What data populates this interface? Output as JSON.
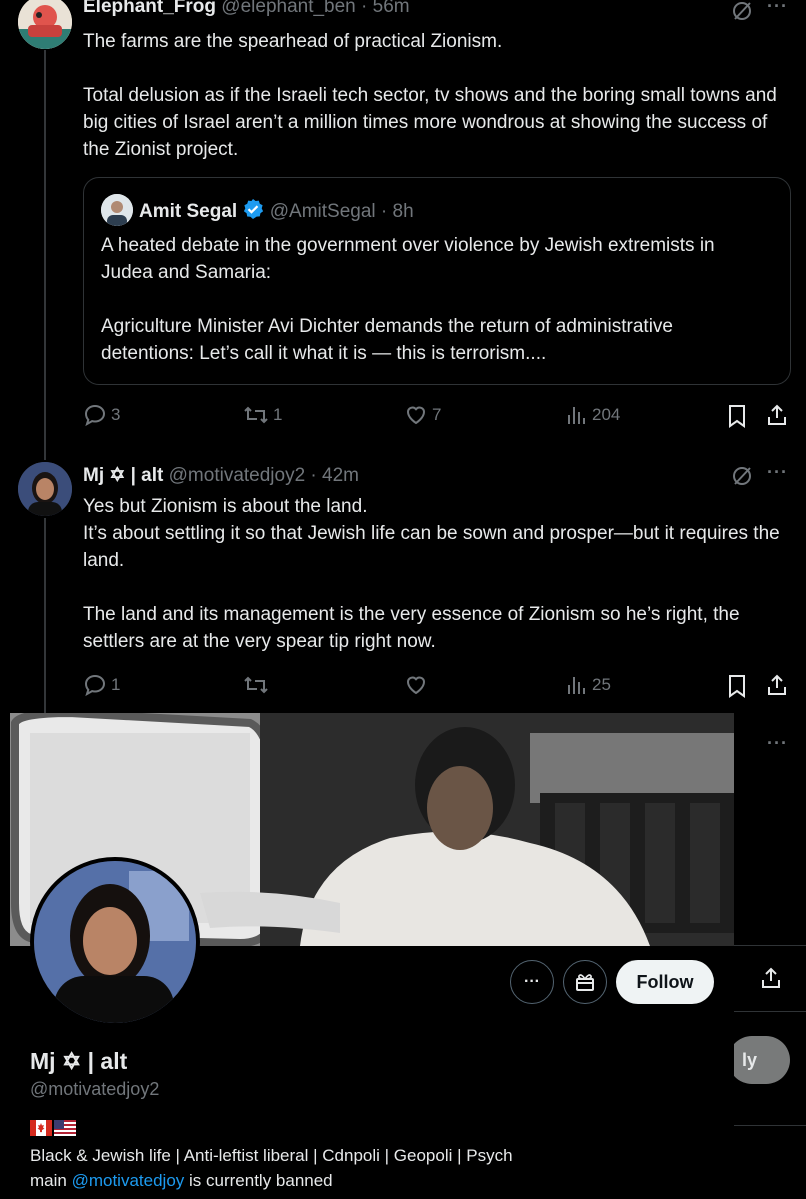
{
  "tweet1": {
    "display_name": "Elephant_Frog",
    "handle_time": "@elephant_ben · 56m",
    "paragraphs": [
      "The farms are the spearhead of practical Zionism.",
      "Total delusion as if the Israeli tech sector, tv shows and the boring small towns and big cities of Israel aren’t a million times more wondrous at showing the success of the Zionist project."
    ],
    "quote": {
      "display_name": "Amit Segal",
      "handle_time": "@AmitSegal · 8h",
      "paragraphs": [
        "A heated debate in the government over violence by Jewish extremists in Judea and Samaria:",
        "Agriculture Minister Avi Dichter demands the return of administrative detentions: Let’s call it what it is — this is terrorism...."
      ]
    },
    "actions": {
      "replies": "3",
      "reposts": "1",
      "likes": "7",
      "views": "204"
    }
  },
  "tweet2": {
    "display_name": "Mj ✡︎ | alt",
    "handle_time": "@motivatedjoy2 · 42m",
    "paragraphs": [
      "Yes but Zionism is about the land.",
      "It’s about settling it so that Jewish life can be sown and prosper—but it requires the land.",
      "The land and its management is the very essence of Zionism so he’s right, the settlers are at the very spear tip right now."
    ],
    "actions": {
      "replies": "1",
      "reposts": "",
      "likes": "",
      "views": "25"
    }
  },
  "profile_card": {
    "display_name": "Mj ✡︎ | alt",
    "handle": "@motivatedjoy2",
    "flags": "🇨🇦🇺🇸",
    "bio_line1": "Black & Jewish life | Anti-leftist liberal | Cdnpoli | Geopoli | Psych",
    "bio_main_prefix": "main ",
    "bio_main_link": "@motivatedjoy",
    "bio_main_suffix": " is currently banned",
    "follow_label": "Follow",
    "more_label": "···"
  },
  "background_reply_label": "ly",
  "colors": {
    "accent": "#1d9bf0",
    "muted": "#71767b",
    "border": "#2f3336",
    "verified": "#1d9bf0"
  }
}
